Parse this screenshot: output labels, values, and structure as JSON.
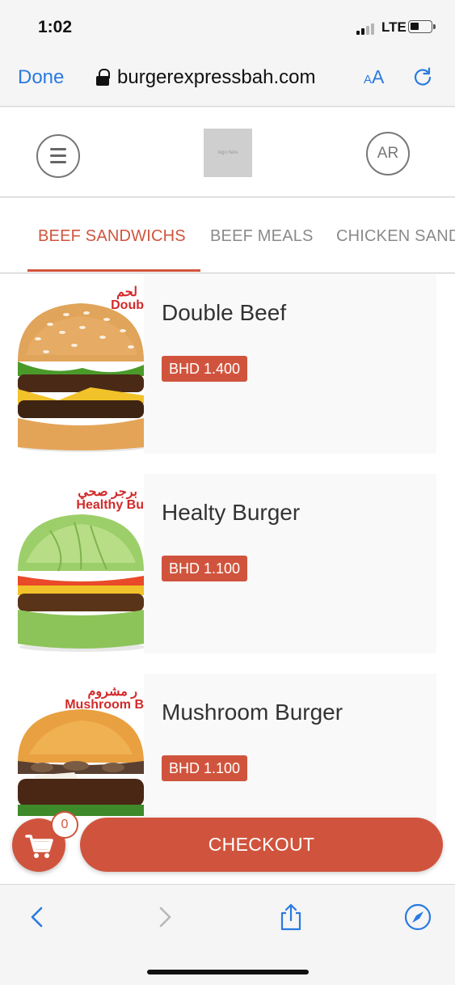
{
  "status_bar": {
    "time": "1:02",
    "network": "LTE"
  },
  "browser": {
    "done_label": "Done",
    "url": "burgerexpressbah.com",
    "aa_small": "A",
    "aa_big": "A"
  },
  "header": {
    "logo_text": "logo here",
    "language_button": "AR"
  },
  "tabs": [
    {
      "label": "BEEF SANDWICHS",
      "active": true
    },
    {
      "label": "BEEF MEALS",
      "active": false
    },
    {
      "label": "CHICKEN SANDWICHS",
      "active": false
    }
  ],
  "products": [
    {
      "name": "Double Beef",
      "price": "BHD 1.400",
      "image_label_ar": "لحم",
      "image_label_en": "Doub"
    },
    {
      "name": "Healty Burger",
      "price": "BHD 1.100",
      "image_label_ar": "برجر صحي",
      "image_label_en": "Healthy Bu"
    },
    {
      "name": "Mushroom Burger",
      "price": "BHD 1.100",
      "image_label_ar": "ر مشروم",
      "image_label_en": "Mushroom B"
    }
  ],
  "cart": {
    "count": "0",
    "checkout_label": "CHECKOUT"
  },
  "colors": {
    "accent": "#d0543d",
    "ios_blue": "#2a7ae2"
  }
}
